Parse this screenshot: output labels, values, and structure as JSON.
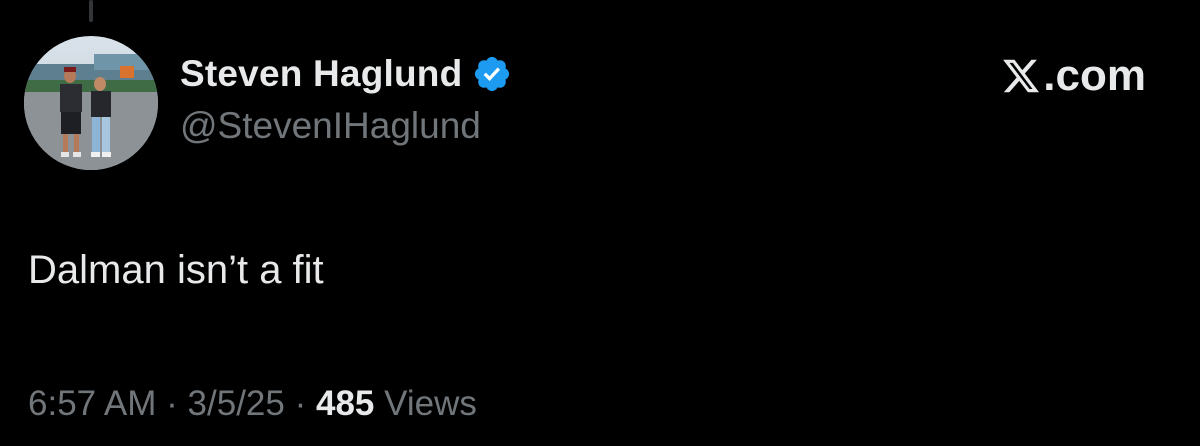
{
  "author": {
    "display_name": "Steven Haglund",
    "handle": "@StevenIHaglund",
    "verified": true,
    "verified_icon": "verified-badge-icon"
  },
  "brand": {
    "logo_icon": "x-logo-icon",
    "suffix": ".com"
  },
  "tweet": {
    "text": "Dalman isn’t a fit",
    "time": "6:57 AM",
    "separator": "·",
    "date": "3/5/25",
    "views_count": "485",
    "views_label": "Views"
  },
  "colors": {
    "background": "#000000",
    "primary_text": "#e7e9ea",
    "secondary_text": "#71767b",
    "verified_badge": "#1d9bf0"
  }
}
